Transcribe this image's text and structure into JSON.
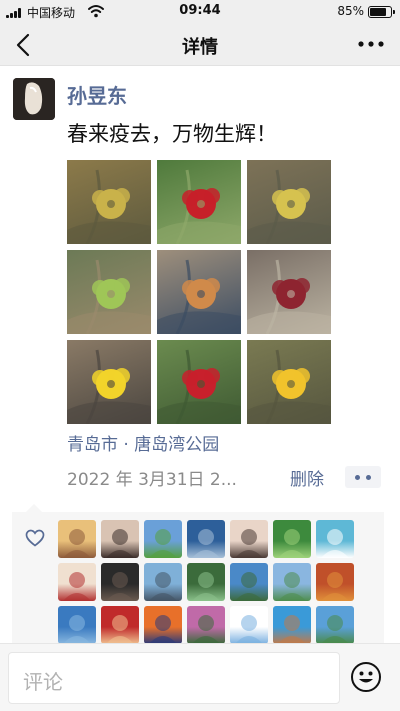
{
  "status_bar": {
    "carrier": "中国移动",
    "time": "09:44",
    "battery": "85%",
    "battery_level": 0.85,
    "icons": [
      "signal-icon",
      "wifi-icon",
      "battery-icon"
    ]
  },
  "nav": {
    "title": "详情",
    "back_icon": "chevron-left-icon",
    "more_icon": "more-dots-icon"
  },
  "post": {
    "author": "孙昱东",
    "text": "春来疫去，万物生辉！",
    "location": "青岛市 · 唐岛湾公园",
    "timestamp": "2022 年 3月31日 2...",
    "delete_label": "删除",
    "photos": [
      {
        "name": "photo-forsythia",
        "colors": [
          "#8c7a4a",
          "#c9b24a",
          "#5d5a3e"
        ]
      },
      {
        "name": "photo-red-camellia",
        "colors": [
          "#4f7a3c",
          "#c72029",
          "#8ea86a"
        ]
      },
      {
        "name": "photo-yellow-branch",
        "colors": [
          "#7d7257",
          "#d6c24f",
          "#5b5b4a"
        ]
      },
      {
        "name": "photo-green-bud",
        "colors": [
          "#6c7a56",
          "#9fc657",
          "#9a8a6c"
        ]
      },
      {
        "name": "photo-ferris-wheel",
        "colors": [
          "#9e8f7c",
          "#d08a4a",
          "#3c4d63"
        ]
      },
      {
        "name": "photo-red-leaves",
        "colors": [
          "#7a6f66",
          "#8e2430",
          "#bbb3a2"
        ]
      },
      {
        "name": "photo-yellow-pansy",
        "colors": [
          "#8a7a66",
          "#f2d32a",
          "#4b4640"
        ]
      },
      {
        "name": "photo-red-daisy",
        "colors": [
          "#6b8b4f",
          "#c8202c",
          "#3f5a33"
        ]
      },
      {
        "name": "photo-pansy-garden",
        "colors": [
          "#7a7a52",
          "#f1c32c",
          "#56563f"
        ]
      }
    ]
  },
  "likes": {
    "icon": "heart-outline-icon",
    "avatars": [
      {
        "name": "liker-avatar-cat",
        "colors": [
          "#e9c07a",
          "#8d5a3a"
        ]
      },
      {
        "name": "liker-avatar-girl",
        "colors": [
          "#d9c3b3",
          "#3b2d2a"
        ]
      },
      {
        "name": "liker-avatar-field",
        "colors": [
          "#6aa0d8",
          "#55a040"
        ]
      },
      {
        "name": "liker-avatar-sea",
        "colors": [
          "#2d5f9a",
          "#a7c0d8"
        ]
      },
      {
        "name": "liker-avatar-woman",
        "colors": [
          "#e9d5c8",
          "#4a3a35"
        ]
      },
      {
        "name": "liker-avatar-lotus",
        "colors": [
          "#3d8a3d",
          "#9ed27a"
        ]
      },
      {
        "name": "liker-avatar-seal",
        "colors": [
          "#5eb8d6",
          "#ffffff"
        ]
      },
      {
        "name": "liker-avatar-anime",
        "colors": [
          "#f0e0d0",
          "#b23232"
        ]
      },
      {
        "name": "liker-avatar-dark-girl",
        "colors": [
          "#2a2a2a",
          "#6a5a50"
        ]
      },
      {
        "name": "liker-avatar-coast",
        "colors": [
          "#7fb0d8",
          "#445566"
        ]
      },
      {
        "name": "liker-avatar-succulent",
        "colors": [
          "#3b6b3b",
          "#8ac08a"
        ]
      },
      {
        "name": "liker-avatar-lake",
        "colors": [
          "#4a89c8",
          "#3c6a3c"
        ]
      },
      {
        "name": "liker-avatar-grassland",
        "colors": [
          "#8ab6e0",
          "#4e8d4e"
        ]
      },
      {
        "name": "liker-avatar-autumn",
        "colors": [
          "#c0502a",
          "#e0903a"
        ]
      },
      {
        "name": "liker-avatar-river",
        "colors": [
          "#3a7ac0",
          "#89b8e0"
        ]
      },
      {
        "name": "liker-avatar-cartoon-red",
        "colors": [
          "#c02a2a",
          "#f0c090"
        ]
      },
      {
        "name": "liker-avatar-sunset",
        "colors": [
          "#e8702a",
          "#2a3a7a"
        ]
      },
      {
        "name": "liker-avatar-orchid",
        "colors": [
          "#c06aa8",
          "#3a6a3a"
        ]
      },
      {
        "name": "liker-avatar-bunny",
        "colors": [
          "#ffffff",
          "#7ab0e0"
        ]
      },
      {
        "name": "liker-avatar-cartoon-boy",
        "colors": [
          "#3a9ad8",
          "#c07a4a"
        ]
      },
      {
        "name": "liker-avatar-island",
        "colors": [
          "#5aa0d8",
          "#4a8a4a"
        ]
      }
    ]
  },
  "comment_bar": {
    "placeholder": "评论",
    "emoji_icon": "emoji-smiley-icon"
  }
}
